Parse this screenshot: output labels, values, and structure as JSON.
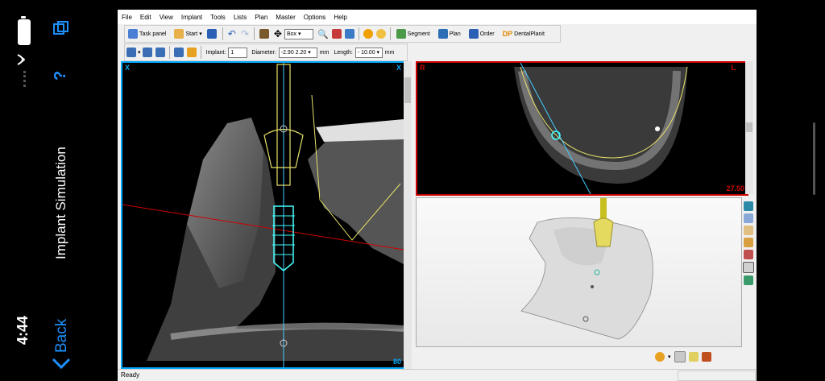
{
  "phone": {
    "time": "4:44",
    "back_label": "Back",
    "title": "Implant Simulation",
    "help_label": "?"
  },
  "menu": [
    "File",
    "Edit",
    "View",
    "Implant",
    "Tools",
    "Lists",
    "Plan",
    "Master",
    "Options",
    "Help"
  ],
  "toolbar1": {
    "task_panel": "Task panel",
    "start": "Start",
    "box_select": "Box",
    "segment": "Segment",
    "plan": "Plan",
    "order": "Order",
    "dentalplanit": "DentalPlanit",
    "dp": "DP"
  },
  "toolbar2": {
    "implant_label": "Implant:",
    "implant_value": "1",
    "diameter_label": "Diameter:",
    "diameter_value": "-2.90  2.20",
    "diameter_unit": "mm",
    "length_label": "Length:",
    "length_value": "- 10.00",
    "length_unit": "mm"
  },
  "views": {
    "cross": {
      "left_label": "X",
      "right_label": "X",
      "slice": "80"
    },
    "axial": {
      "left_label": "R",
      "right_label": "L",
      "value": "27.50"
    }
  },
  "status": "Ready",
  "colors": {
    "cyan": "#00aaff",
    "red": "#d00000",
    "implant": "#e8e26a",
    "aqua": "#44ffff"
  }
}
